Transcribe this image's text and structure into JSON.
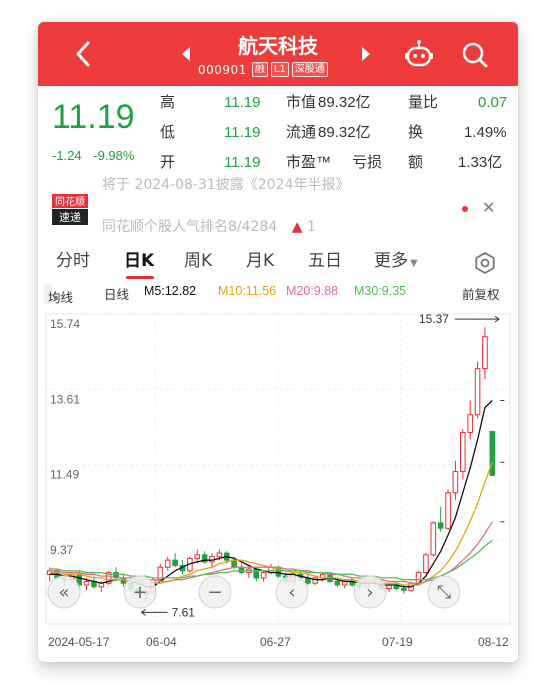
{
  "header": {
    "stock_name": "航天科技",
    "code": "000901",
    "badges": [
      "融",
      "L1",
      "深股通"
    ],
    "colors": {
      "bar": "#ee3c3c"
    }
  },
  "quote": {
    "price": "11.19",
    "change": "-1.24",
    "change_pct": "-9.98%",
    "rows": [
      {
        "l1": "高",
        "v1": "11.19",
        "l2": "市值",
        "v2": "89.32亿",
        "l3": "量比",
        "v3": "0.07"
      },
      {
        "l1": "低",
        "v1": "11.19",
        "l2": "流通",
        "v2": "89.32亿",
        "l3": "换",
        "v3": "1.49%"
      },
      {
        "l1": "开",
        "v1": "11.19",
        "l2": "市盈™",
        "v2": "亏损",
        "l3": "额",
        "v3": "1.33亿"
      }
    ]
  },
  "news": {
    "logo_text": [
      "同花顺",
      "速递"
    ],
    "line1": "将于 2024-08-31披露《2024年半报》",
    "line2": "同花顺个股人气排名8/4284",
    "line2_extra": "1"
  },
  "tabs": [
    "分时",
    "日K",
    "周K",
    "月K",
    "五日",
    "更多"
  ],
  "active_tab": "日K",
  "legend": {
    "ma_select": "均线",
    "kline_label": "日线",
    "ma5": "M5:12.82",
    "ma10": "M10:11.56",
    "ma20": "M20:9.88",
    "ma30": "M30:9.35",
    "adjust": "前复权",
    "colors": {
      "ma5": "#111111",
      "ma10": "#e0a516",
      "ma20": "#e0708a",
      "ma30": "#5cb85c"
    }
  },
  "chart_data": {
    "type": "candlestick",
    "y_ticks": [
      "15.74",
      "13.61",
      "11.49",
      "9.37"
    ],
    "x_ticks": [
      "2024-05-17",
      "06-04",
      "06-27",
      "07-19",
      "08-12"
    ],
    "max_label": "15.37",
    "min_label": "7.61",
    "ylim": [
      7.0,
      15.74
    ],
    "candles": [
      [
        8.4,
        8.6,
        8.2,
        8.5
      ],
      [
        8.5,
        8.55,
        8.2,
        8.3
      ],
      [
        8.3,
        8.4,
        8.1,
        8.25
      ],
      [
        8.25,
        8.45,
        8.15,
        8.4
      ],
      [
        8.4,
        8.5,
        8.0,
        8.1
      ],
      [
        8.1,
        8.3,
        7.95,
        8.2
      ],
      [
        8.2,
        8.35,
        8.0,
        8.05
      ],
      [
        8.05,
        8.2,
        7.9,
        8.15
      ],
      [
        8.15,
        8.5,
        8.1,
        8.45
      ],
      [
        8.45,
        8.6,
        8.2,
        8.3
      ],
      [
        8.3,
        8.4,
        8.05,
        8.15
      ],
      [
        8.15,
        8.2,
        7.9,
        8.0
      ],
      [
        8.0,
        8.15,
        7.8,
        7.85
      ],
      [
        7.85,
        8.0,
        7.61,
        7.9
      ],
      [
        7.9,
        8.3,
        7.85,
        8.25
      ],
      [
        8.25,
        8.7,
        8.2,
        8.6
      ],
      [
        8.6,
        8.9,
        8.5,
        8.8
      ],
      [
        8.8,
        9.0,
        8.6,
        8.65
      ],
      [
        8.65,
        8.8,
        8.4,
        8.5
      ],
      [
        8.5,
        8.9,
        8.45,
        8.85
      ],
      [
        8.85,
        9.1,
        8.7,
        8.95
      ],
      [
        8.95,
        9.05,
        8.7,
        8.75
      ],
      [
        8.75,
        9.0,
        8.6,
        8.9
      ],
      [
        8.9,
        9.1,
        8.8,
        9.0
      ],
      [
        9.0,
        9.05,
        8.7,
        8.8
      ],
      [
        8.8,
        8.9,
        8.55,
        8.6
      ],
      [
        8.6,
        8.7,
        8.4,
        8.45
      ],
      [
        8.45,
        8.6,
        8.3,
        8.55
      ],
      [
        8.55,
        8.6,
        8.2,
        8.3
      ],
      [
        8.3,
        8.5,
        8.2,
        8.45
      ],
      [
        8.45,
        8.7,
        8.4,
        8.6
      ],
      [
        8.6,
        8.65,
        8.3,
        8.35
      ],
      [
        8.35,
        8.45,
        8.1,
        8.2
      ],
      [
        8.2,
        8.45,
        8.15,
        8.4
      ],
      [
        8.4,
        8.5,
        8.2,
        8.3
      ],
      [
        8.3,
        8.4,
        8.1,
        8.15
      ],
      [
        8.15,
        8.35,
        8.1,
        8.3
      ],
      [
        8.3,
        8.45,
        8.2,
        8.4
      ],
      [
        8.4,
        8.45,
        8.15,
        8.2
      ],
      [
        8.2,
        8.3,
        8.05,
        8.1
      ],
      [
        8.1,
        8.25,
        8.0,
        8.2
      ],
      [
        8.2,
        8.3,
        8.05,
        8.1
      ],
      [
        8.1,
        8.2,
        7.95,
        8.05
      ],
      [
        8.05,
        8.25,
        8.0,
        8.2
      ],
      [
        8.2,
        8.35,
        8.1,
        8.15
      ],
      [
        8.15,
        8.2,
        7.95,
        8.0
      ],
      [
        8.0,
        8.15,
        7.9,
        8.1
      ],
      [
        8.1,
        8.2,
        7.95,
        8.0
      ],
      [
        8.0,
        8.1,
        7.85,
        7.95
      ],
      [
        7.95,
        8.2,
        7.9,
        8.15
      ],
      [
        8.15,
        8.5,
        8.1,
        8.45
      ],
      [
        8.45,
        9.0,
        8.4,
        8.95
      ],
      [
        8.95,
        9.9,
        8.9,
        9.85
      ],
      [
        9.85,
        10.3,
        9.6,
        9.7
      ],
      [
        9.7,
        10.8,
        9.65,
        10.7
      ],
      [
        10.7,
        11.6,
        10.5,
        11.3
      ],
      [
        11.3,
        12.5,
        11.1,
        12.4
      ],
      [
        12.4,
        13.3,
        12.2,
        12.9
      ],
      [
        12.9,
        14.4,
        12.8,
        14.2
      ],
      [
        14.2,
        15.37,
        13.9,
        15.1
      ],
      [
        12.43,
        12.43,
        11.19,
        11.19
      ]
    ],
    "ma_series": {
      "ma5": [
        8.4,
        8.4,
        8.35,
        8.35,
        8.3,
        8.25,
        8.2,
        8.15,
        8.2,
        8.25,
        8.25,
        8.2,
        8.15,
        8.05,
        8.05,
        8.2,
        8.35,
        8.5,
        8.6,
        8.7,
        8.75,
        8.8,
        8.8,
        8.85,
        8.9,
        8.85,
        8.75,
        8.65,
        8.55,
        8.5,
        8.45,
        8.45,
        8.4,
        8.4,
        8.35,
        8.3,
        8.25,
        8.25,
        8.3,
        8.25,
        8.2,
        8.2,
        8.15,
        8.15,
        8.15,
        8.1,
        8.1,
        8.1,
        8.05,
        8.05,
        8.15,
        8.35,
        8.7,
        9.05,
        9.5,
        10.0,
        10.7,
        11.4,
        12.2,
        13.1,
        13.3
      ],
      "ma10": [
        8.45,
        8.45,
        8.4,
        8.4,
        8.4,
        8.35,
        8.3,
        8.3,
        8.25,
        8.25,
        8.25,
        8.2,
        8.2,
        8.15,
        8.15,
        8.15,
        8.2,
        8.25,
        8.35,
        8.4,
        8.5,
        8.55,
        8.6,
        8.7,
        8.75,
        8.8,
        8.8,
        8.75,
        8.7,
        8.65,
        8.6,
        8.55,
        8.5,
        8.45,
        8.45,
        8.4,
        8.35,
        8.3,
        8.3,
        8.3,
        8.25,
        8.25,
        8.2,
        8.2,
        8.2,
        8.15,
        8.15,
        8.15,
        8.1,
        8.1,
        8.1,
        8.2,
        8.35,
        8.5,
        8.75,
        9.05,
        9.45,
        9.9,
        10.4,
        11.0,
        11.56
      ],
      "ma20": [
        8.5,
        8.5,
        8.45,
        8.45,
        8.45,
        8.4,
        8.4,
        8.35,
        8.35,
        8.3,
        8.3,
        8.3,
        8.25,
        8.25,
        8.25,
        8.2,
        8.2,
        8.25,
        8.25,
        8.3,
        8.35,
        8.4,
        8.45,
        8.5,
        8.55,
        8.6,
        8.6,
        8.6,
        8.6,
        8.6,
        8.6,
        8.6,
        8.55,
        8.55,
        8.5,
        8.5,
        8.45,
        8.45,
        8.4,
        8.4,
        8.35,
        8.3,
        8.3,
        8.25,
        8.25,
        8.25,
        8.2,
        8.2,
        8.2,
        8.15,
        8.15,
        8.2,
        8.25,
        8.35,
        8.45,
        8.6,
        8.8,
        9.0,
        9.25,
        9.55,
        9.88
      ],
      "ma30": [
        8.55,
        8.55,
        8.5,
        8.5,
        8.5,
        8.45,
        8.45,
        8.45,
        8.4,
        8.4,
        8.4,
        8.35,
        8.35,
        8.35,
        8.3,
        8.3,
        8.3,
        8.3,
        8.3,
        8.35,
        8.35,
        8.4,
        8.4,
        8.45,
        8.45,
        8.5,
        8.5,
        8.5,
        8.5,
        8.5,
        8.5,
        8.5,
        8.5,
        8.5,
        8.5,
        8.45,
        8.45,
        8.45,
        8.45,
        8.4,
        8.4,
        8.4,
        8.35,
        8.35,
        8.35,
        8.3,
        8.3,
        8.3,
        8.25,
        8.25,
        8.25,
        8.25,
        8.3,
        8.35,
        8.45,
        8.55,
        8.7,
        8.85,
        9.0,
        9.2,
        9.35
      ]
    },
    "up_color": "#e5323a",
    "down_color": "#22a046"
  }
}
